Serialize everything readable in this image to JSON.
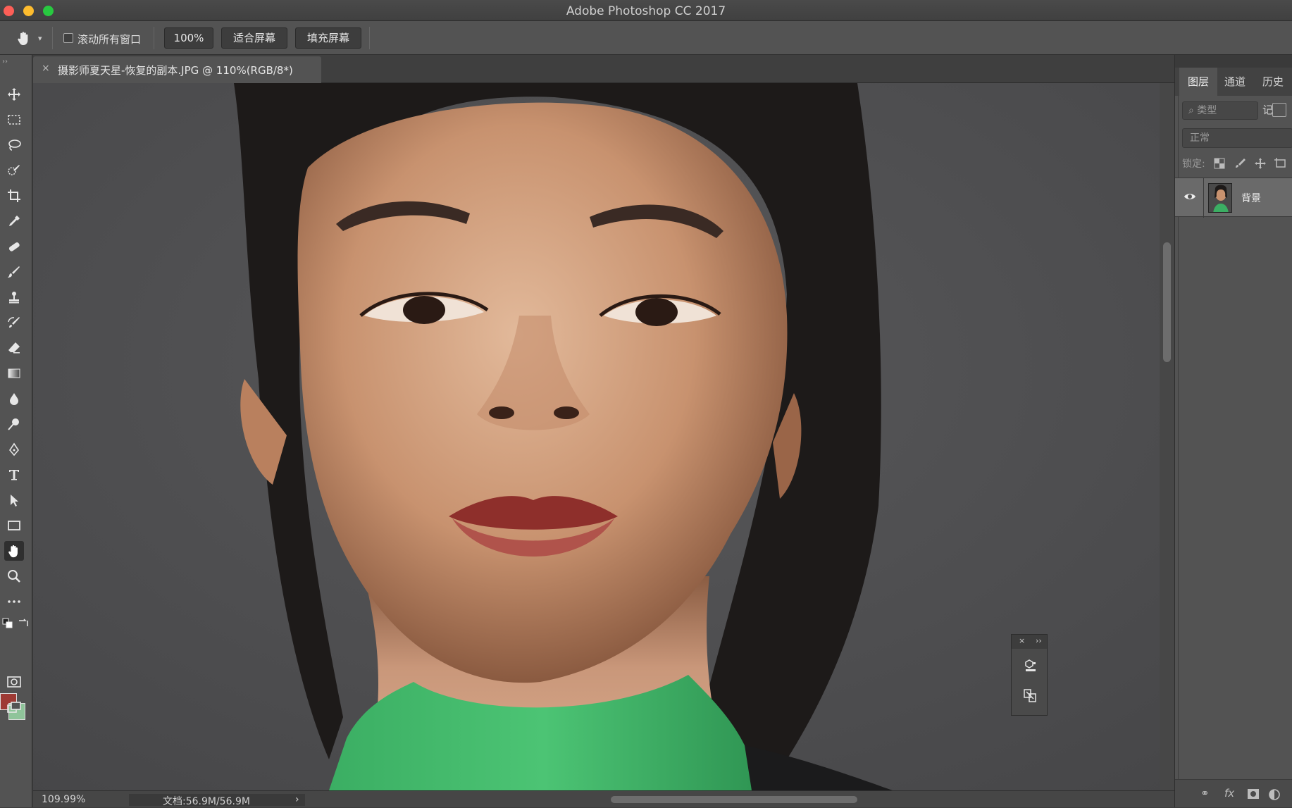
{
  "window": {
    "title": "Adobe Photoshop CC 2017"
  },
  "options_bar": {
    "scroll_all_label": "滚动所有窗口",
    "zoom_btn": "100%",
    "fit_btn": "适合屏幕",
    "fill_btn": "填充屏幕"
  },
  "document": {
    "tab_title": "摄影师夏天星-恢复的副本.JPG @ 110%(RGB/8*)",
    "close_glyph": "×"
  },
  "status": {
    "zoom": "109.99%",
    "doc_size": "文档:56.9M/56.9M",
    "arrow": "›"
  },
  "colors": {
    "foreground": "#9e3a34",
    "background": "#8fc49a"
  },
  "layers_panel": {
    "tabs": [
      "图层",
      "通道",
      "历史记"
    ],
    "filter_placeholder": "类型",
    "blend_mode": "正常",
    "lock_label": "锁定:",
    "layer_name": "背景",
    "bottom_link": "⚭",
    "bottom_fx": "fx"
  },
  "float_panel": {
    "close": "×",
    "expand": "››"
  },
  "toolbox": {
    "grip": "››"
  }
}
